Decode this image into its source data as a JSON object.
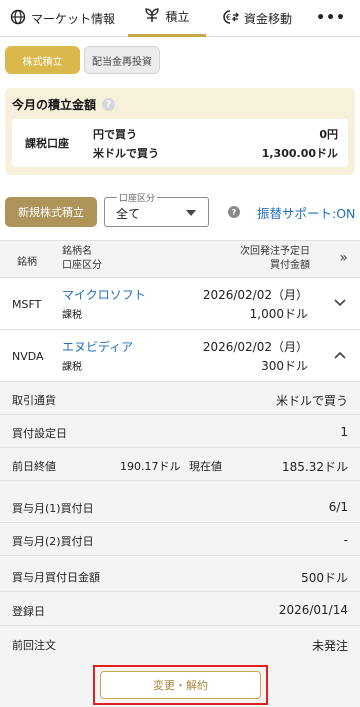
{
  "nav": {
    "market": "マーケット情報",
    "tsumitate": "積立",
    "shikin": "資金移動",
    "more": "•••"
  },
  "chips": {
    "active": "株式積立",
    "inactive": "配当金再投資"
  },
  "summary": {
    "title": "今月の積立金額",
    "help": "?",
    "account": "課税口座",
    "rows": [
      {
        "label": "円で買う",
        "value": "0円"
      },
      {
        "label": "米ドルで買う",
        "value": "1,300.00ドル"
      }
    ]
  },
  "controls": {
    "new_button": "新規株式積立",
    "select_legend": "口座区分",
    "select_value": "全て",
    "help": "?",
    "transfer_link": "振替サポート:ON"
  },
  "table": {
    "headers": {
      "meigara": "銘柄",
      "name_line1": "銘柄名",
      "name_line2": "口座区分",
      "date_line1": "次回発注予定日",
      "date_line2": "買付金額",
      "expand": "»"
    },
    "rows": [
      {
        "ticker": "MSFT",
        "name": "マイクロソフト",
        "account": "課税",
        "date": "2026/02/02（月）",
        "amount": "1,000ドル",
        "chevron": "⌄"
      },
      {
        "ticker": "NVDA",
        "name": "エヌビディア",
        "account": "課税",
        "date": "2026/02/02（月）",
        "amount": "300ドル",
        "chevron": "^"
      }
    ]
  },
  "details": {
    "currency_label": "取引通貨",
    "currency_value": "米ドルで買う",
    "buy_day_label": "買付設定日",
    "buy_day_value": "1",
    "prev_close_label": "前日終値",
    "prev_close_value": "190.17ドル",
    "current_label": "現在値",
    "current_value": "185.32ドル",
    "bonus1_label": "買与月(1)買付日",
    "bonus1_value": "6/1",
    "bonus2_label": "買与月(2)買付日",
    "bonus2_value": "-",
    "bonus_amount_label": "買与月買付日金額",
    "bonus_amount_value": "500ドル",
    "registered_label": "登録日",
    "registered_value": "2026/01/14",
    "last_order_label": "前回注文",
    "last_order_value": "未発注",
    "change_button": "変更・解約"
  },
  "colors": {
    "gold": "#d9b94b",
    "link": "#1f6fbf",
    "highlight": "#e02020"
  }
}
